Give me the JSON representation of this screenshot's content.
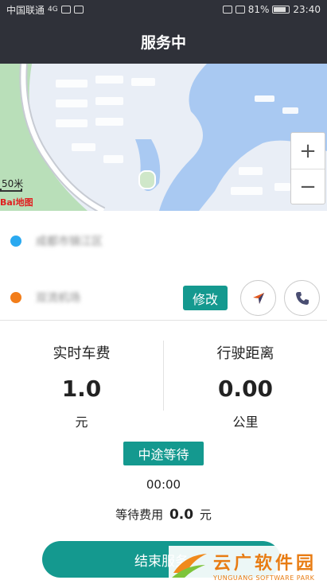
{
  "status_bar": {
    "carrier": "中国联通",
    "network": "4G",
    "battery": "81%",
    "time": "23:40"
  },
  "header": {
    "title": "服务中"
  },
  "map": {
    "scale_label": "50米",
    "logo_text": "Bai地图",
    "zoom_in_label": "+",
    "zoom_out_label": "−"
  },
  "route": {
    "start_address": "成都市锦江区",
    "end_address": "双流机场",
    "start_color": "#2aa9f0",
    "end_color": "#f27d1a",
    "modify_label": "修改",
    "navigate_icon": "navigation-arrow-icon",
    "phone_icon": "phone-icon"
  },
  "stats": {
    "fare_label": "实时车费",
    "fare_value": "1.0",
    "fare_unit": "元",
    "distance_label": "行驶距离",
    "distance_value": "0.00",
    "distance_unit": "公里"
  },
  "waiting": {
    "button_label": "中途等待",
    "timer": "00:00",
    "fee_label": "等待费用",
    "fee_value": "0.0",
    "fee_unit": "元"
  },
  "end_button_label": "结束服务",
  "watermark": {
    "cn": "云广软件园",
    "en": "YUNGUANG SOFTWARE PARK"
  },
  "colors": {
    "accent": "#14998f",
    "header_bg": "#2f3139"
  }
}
